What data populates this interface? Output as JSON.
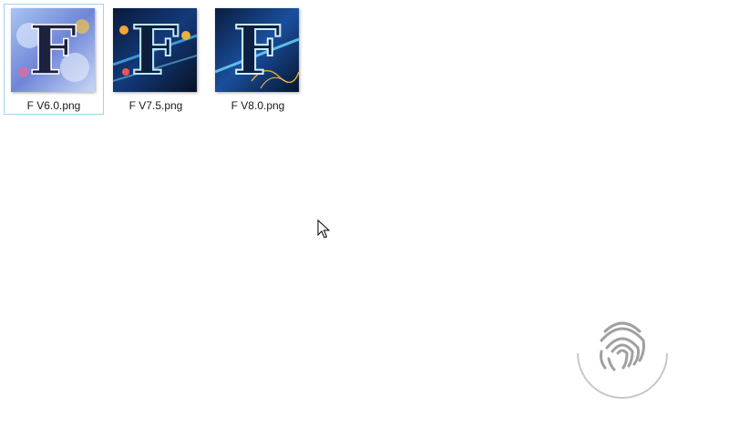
{
  "files": [
    {
      "name": "F V6.0.png",
      "selected": true,
      "icon": "image-thumbnail-icon"
    },
    {
      "name": "F V7.5.png",
      "selected": false,
      "icon": "image-thumbnail-icon"
    },
    {
      "name": "F V8.0.png",
      "selected": false,
      "icon": "image-thumbnail-icon"
    }
  ],
  "colors": {
    "selection_border": "#9fd2f2",
    "background": "#ffffff",
    "label_text": "#1a1a1a"
  },
  "overlay": {
    "cursor_icon": "mouse-pointer-icon",
    "fingerprint_icon": "fingerprint-icon"
  }
}
